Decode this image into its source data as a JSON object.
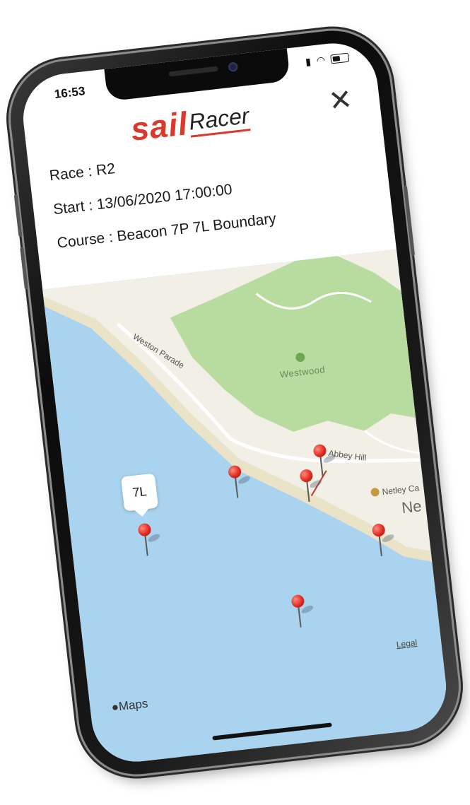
{
  "status_bar": {
    "time": "16:53"
  },
  "header": {
    "logo_sail": "sail",
    "logo_racer": "Racer",
    "close_label": "✕"
  },
  "race_info": {
    "race": "Race : R2",
    "start": "Start : 13/06/2020 17:00:00",
    "course": "Course : Beacon 7P 7L Boundary"
  },
  "map": {
    "callout_label": "7L",
    "place_labels": {
      "weston_parade": "Weston Parade",
      "westwood": "Westwood",
      "abbey_hill": "Abbey Hill",
      "netley": "Netley Ca",
      "ne": "Ne"
    },
    "attribution": "Maps",
    "legal": "Legal",
    "colors": {
      "water": "#a9d3ee",
      "land": "#f2efe6",
      "park": "#b8dca0",
      "pin": "#e02a1e"
    }
  }
}
